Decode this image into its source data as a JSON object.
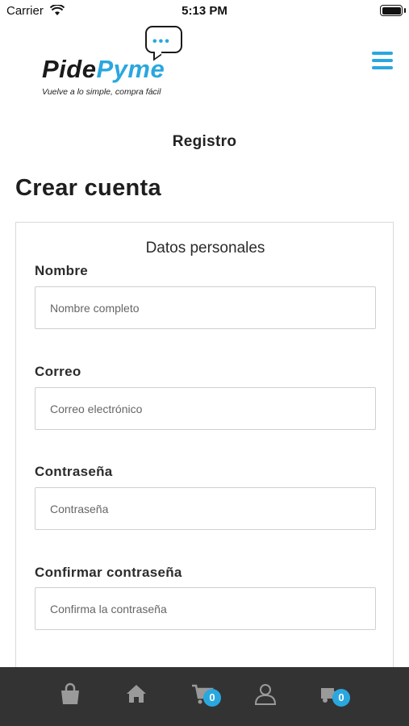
{
  "status_bar": {
    "carrier": "Carrier",
    "time": "5:13 PM",
    "wifi_icon": "wifi-icon",
    "battery_icon": "battery-icon"
  },
  "header": {
    "logo": {
      "word1": "Pide",
      "word2": "Pyme",
      "bubble_dots": "•••",
      "tagline": "Vuelve a lo simple, compra fácil",
      "accent_color": "#2aa7df"
    },
    "menu_icon": "hamburger-menu-icon"
  },
  "page": {
    "heading": "Registro",
    "title": "Crear cuenta"
  },
  "form": {
    "section_title": "Datos personales",
    "fields": [
      {
        "label": "Nombre",
        "placeholder": "Nombre completo",
        "value": ""
      },
      {
        "label": "Correo",
        "placeholder": "Correo electrónico",
        "value": ""
      },
      {
        "label": "Contraseña",
        "placeholder": "Contraseña",
        "value": ""
      },
      {
        "label": "Confirmar contraseña",
        "placeholder": "Confirma la contraseña",
        "value": ""
      }
    ]
  },
  "tab_bar": {
    "background": "#333333",
    "tabs": [
      {
        "icon": "shopping-bag-icon"
      },
      {
        "icon": "home-icon"
      },
      {
        "icon": "cart-icon",
        "badge": "0"
      },
      {
        "icon": "user-icon"
      },
      {
        "icon": "delivery-truck-icon",
        "badge": "0"
      }
    ]
  }
}
